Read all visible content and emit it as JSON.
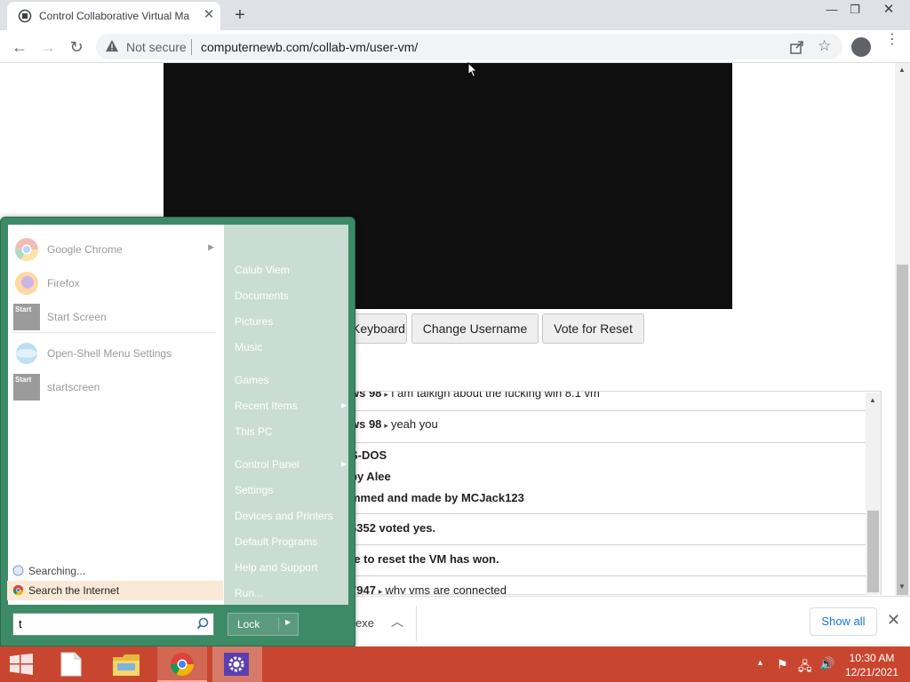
{
  "browser": {
    "tab_title": "Control Collaborative Virtual Ma",
    "security_label": "Not secure",
    "url": "computernewb.com/collab-vm/user-vm/"
  },
  "page": {
    "buttons": [
      {
        "label": "Keyboard"
      },
      {
        "label": "Change Username"
      },
      {
        "label": "Vote for Reset"
      }
    ],
    "chat": [
      {
        "user": "ws 98",
        "message": "I am talkigh about the fucking win 8.1 vm"
      },
      {
        "user": "ws 98",
        "message": "yeah you"
      },
      {
        "user": "",
        "message": "S-DOS"
      },
      {
        "user": "",
        "message": "by Alee"
      },
      {
        "user": "",
        "message": "mmed and made by MCJack123"
      },
      {
        "user": "",
        "message": "6352 voted yes."
      },
      {
        "user": "",
        "message": "te to reset the VM has won."
      },
      {
        "user": "7947",
        "message": "why vms are connected"
      }
    ],
    "download": {
      "filename_tail": "exe",
      "show_all": "Show all"
    }
  },
  "start_menu": {
    "programs": [
      {
        "label": "Google Chrome",
        "icon": "chrome-icon",
        "has_submenu": true
      },
      {
        "label": "Firefox",
        "icon": "firefox-icon",
        "has_submenu": false
      },
      {
        "label": "Start Screen",
        "icon": "start-screen-icon",
        "has_submenu": false
      },
      {
        "label": "Open-Shell Menu Settings",
        "icon": "open-shell-icon",
        "has_submenu": false
      },
      {
        "label": "startscreen",
        "icon": "start-screen-icon",
        "has_submenu": false
      }
    ],
    "right_items": [
      {
        "label": "Calub Viem",
        "has_submenu": false
      },
      {
        "label": "Documents",
        "has_submenu": false
      },
      {
        "label": "Pictures",
        "has_submenu": false
      },
      {
        "label": "Music",
        "has_submenu": false
      },
      {
        "label": "Games",
        "has_submenu": false
      },
      {
        "label": "Recent Items",
        "has_submenu": true
      },
      {
        "label": "This PC",
        "has_submenu": false
      },
      {
        "label": "Control Panel",
        "has_submenu": true
      },
      {
        "label": "Settings",
        "has_submenu": false
      },
      {
        "label": "Devices and Printers",
        "has_submenu": false
      },
      {
        "label": "Default Programs",
        "has_submenu": false
      },
      {
        "label": "Help and Support",
        "has_submenu": false
      },
      {
        "label": "Run...",
        "has_submenu": false
      }
    ],
    "searching_label": "Searching...",
    "search_internet_label": "Search the Internet",
    "search_value": "t",
    "lock_label": "Lock",
    "tile_label": "Start"
  },
  "taskbar": {
    "time": "10:30 AM",
    "date": "12/21/2021"
  },
  "colors": {
    "start_menu_frame": "#3d8a66",
    "taskbar": "#c8462f",
    "link_blue": "#1a73e8"
  }
}
